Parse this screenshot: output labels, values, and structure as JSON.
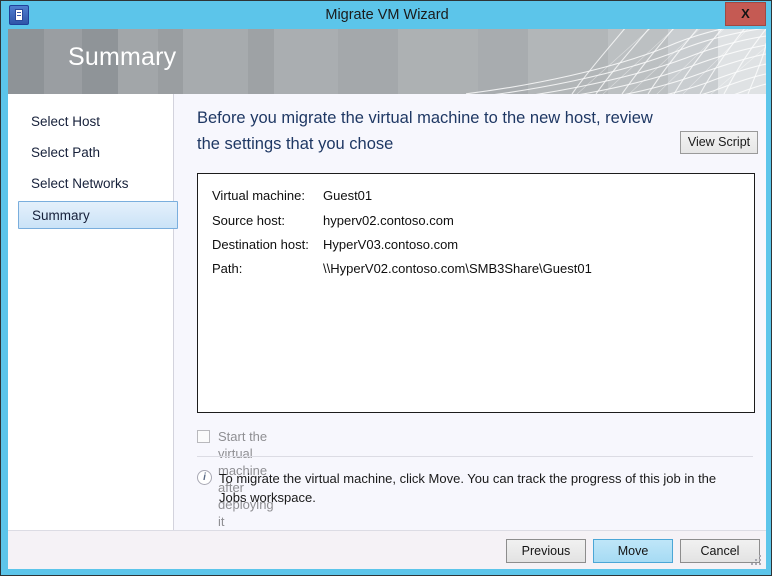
{
  "window": {
    "title": "Migrate VM Wizard",
    "app_icon": "vm-server-icon",
    "close_label": "X",
    "accent_color": "#5cc5ea",
    "close_color": "#c55a53"
  },
  "banner": {
    "title": "Summary"
  },
  "sidebar": {
    "items": [
      {
        "label": "Select Host",
        "selected": false
      },
      {
        "label": "Select Path",
        "selected": false
      },
      {
        "label": "Select Networks",
        "selected": false
      },
      {
        "label": "Summary",
        "selected": true
      }
    ]
  },
  "main": {
    "heading": "Before you migrate the virtual machine to the new host, review the settings that you chose",
    "view_script_label": "View Script",
    "summary_rows": [
      {
        "label": "Virtual machine:",
        "value": "Guest01"
      },
      {
        "label": "Source host:",
        "value": "hyperv02.contoso.com"
      },
      {
        "label": "Destination host:",
        "value": "HyperV03.contoso.com"
      },
      {
        "label": "Path:",
        "value": "\\\\HyperV02.contoso.com\\SMB3Share\\Guest01"
      }
    ],
    "start_checkbox": {
      "label": "Start the virtual machine after deploying it",
      "checked": false,
      "disabled": true
    },
    "info": {
      "icon": "info-icon",
      "symbol": "i",
      "text": "To migrate the virtual machine, click Move. You can track the progress of this job in the Jobs workspace."
    }
  },
  "footer": {
    "previous_label": "Previous",
    "move_label": "Move",
    "cancel_label": "Cancel"
  }
}
